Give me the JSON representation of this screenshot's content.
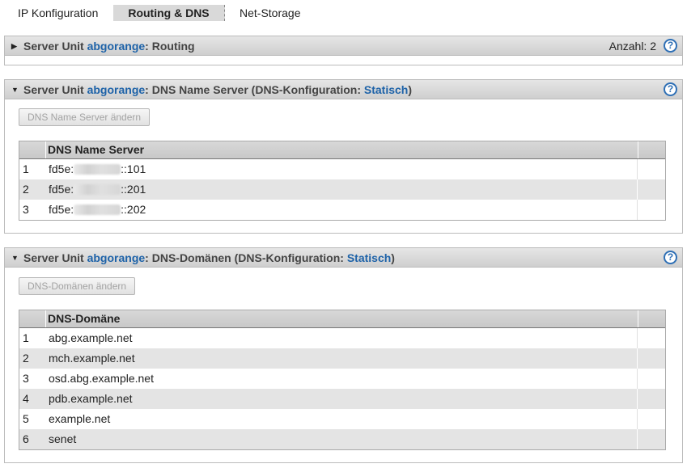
{
  "tabs": [
    {
      "label": "IP Konfiguration"
    },
    {
      "label": "Routing & DNS"
    },
    {
      "label": "Net-Storage"
    }
  ],
  "routing_panel": {
    "prefix": "Server Unit ",
    "unit": "abgorange",
    "suffix": ": Routing",
    "count": "Anzahl: 2",
    "help": "?"
  },
  "dns_server_panel": {
    "prefix": "Server Unit ",
    "unit": "abgorange",
    "mid": ": DNS Name Server (DNS-Konfiguration: ",
    "mode": "Statisch",
    "close": ")",
    "help": "?",
    "button": "DNS Name Server ändern",
    "column": "DNS Name Server",
    "rows": [
      {
        "n": "1",
        "pre": "fd5e:",
        "post": "::101"
      },
      {
        "n": "2",
        "pre": "fd5e:",
        "post": "::201"
      },
      {
        "n": "3",
        "pre": "fd5e:",
        "post": "::202"
      }
    ]
  },
  "dns_domain_panel": {
    "prefix": "Server Unit ",
    "unit": "abgorange",
    "mid": ": DNS-Domänen (DNS-Konfiguration: ",
    "mode": "Statisch",
    "close": ")",
    "help": "?",
    "button": "DNS-Domänen ändern",
    "column": "DNS-Domäne",
    "rows": [
      {
        "n": "1",
        "v": "abg.example.net"
      },
      {
        "n": "2",
        "v": "mch.example.net"
      },
      {
        "n": "3",
        "v": "osd.abg.example.net"
      },
      {
        "n": "4",
        "v": "pdb.example.net"
      },
      {
        "n": "5",
        "v": "example.net"
      },
      {
        "n": "6",
        "v": "senet"
      }
    ]
  },
  "icons": {
    "collapsed": "triangle-right-icon",
    "expanded": "triangle-down-icon",
    "help": "help-icon"
  },
  "colors": {
    "link": "#1d62a8",
    "help": "#2e6fb5",
    "header_bg": "#d5d5d5",
    "row_alt": "#e4e4e4"
  }
}
